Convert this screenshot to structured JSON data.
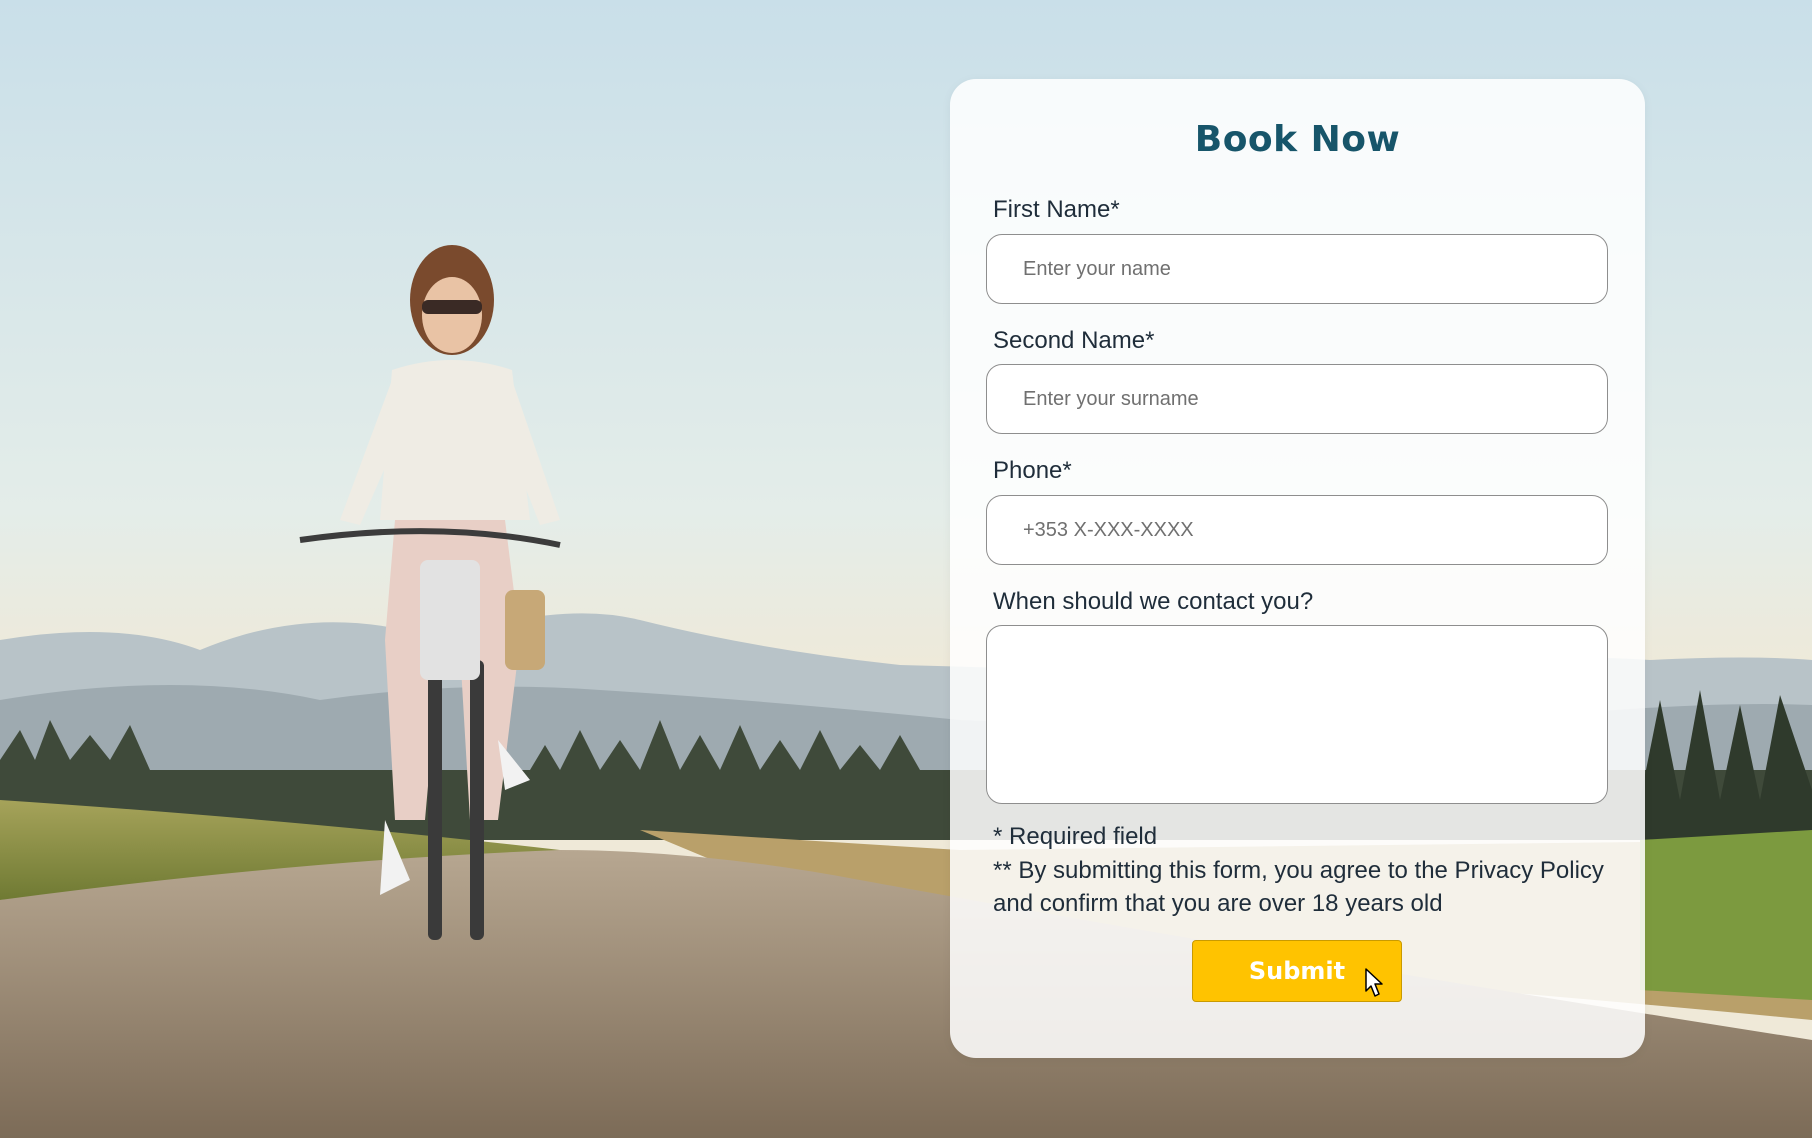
{
  "form": {
    "title": "Book Now",
    "first_name": {
      "label": "First Name*",
      "placeholder": "Enter your name",
      "value": ""
    },
    "second_name": {
      "label": "Second Name*",
      "placeholder": "Enter your surname",
      "value": ""
    },
    "phone": {
      "label": "Phone*",
      "placeholder": "+353 X-XXX-XXXX",
      "value": ""
    },
    "contact_time": {
      "label": "When should we contact you?",
      "value": ""
    },
    "notes": {
      "required": "* Required field",
      "privacy": "** By submitting this form, you agree to the Privacy Policy and confirm that you are over 18 years old"
    },
    "submit_label": "Submit"
  },
  "colors": {
    "title": "#17556a",
    "submit_bg": "#ffc300",
    "label_text": "#1f2d3a"
  },
  "icons": {
    "cursor": "mouse-pointer-icon"
  }
}
